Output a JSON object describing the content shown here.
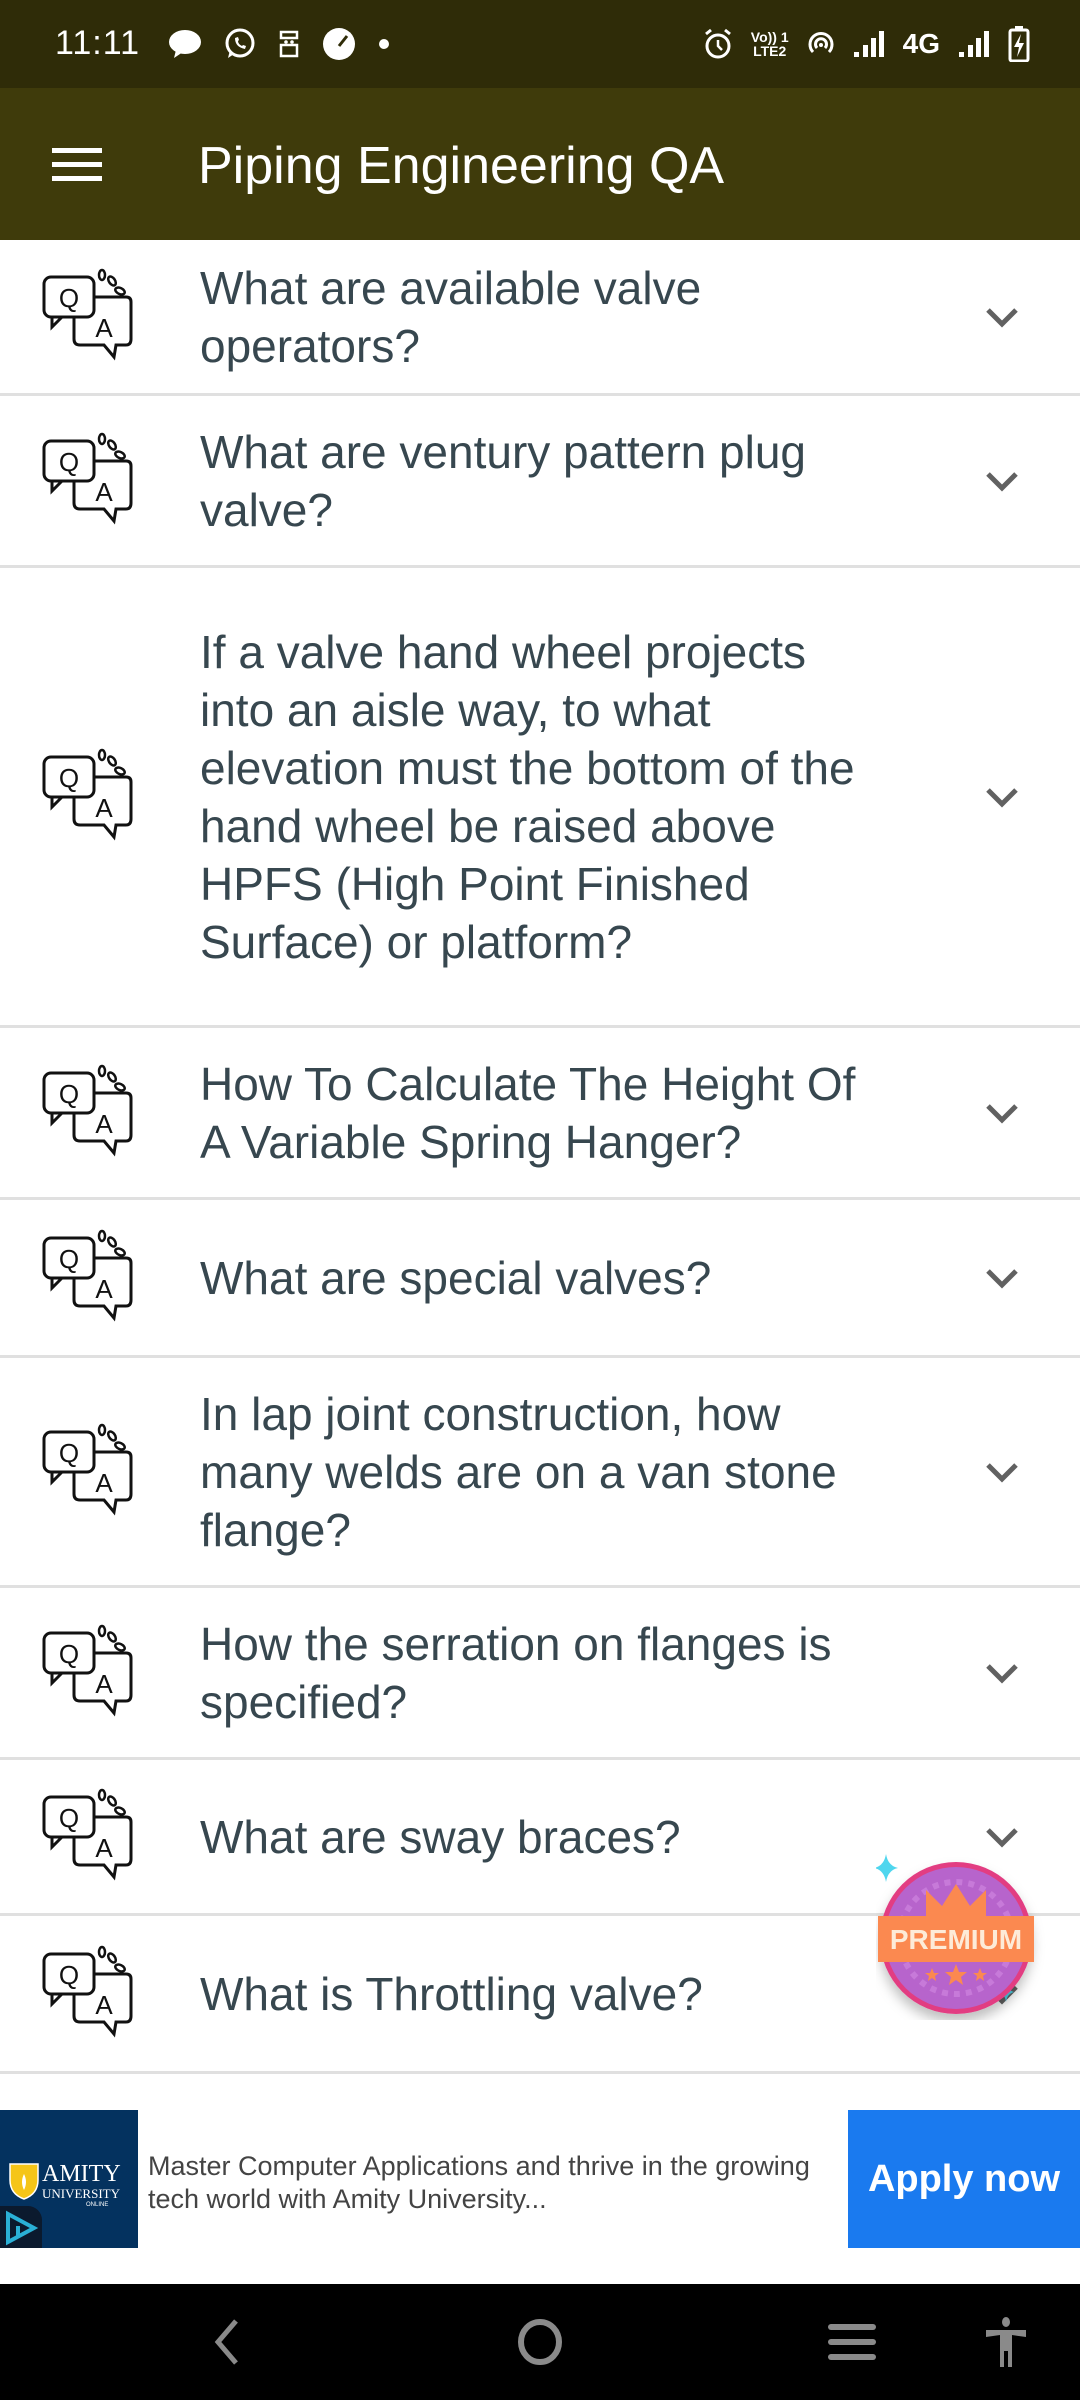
{
  "status_bar": {
    "time": "11:11",
    "left_icons": [
      "chat-bubble-icon",
      "whatsapp-icon",
      "robot-icon",
      "speedometer-icon",
      "more-notifications-dot-icon"
    ],
    "right_icons": [
      "alarm-icon",
      "volte-icon",
      "hotspot-icon",
      "signal-icon",
      "signal-icon"
    ],
    "volte_line1": "Vo)) 1",
    "volte_line2": "LTE2",
    "network_type": "4G"
  },
  "app_bar": {
    "title": "Piping Engineering QA",
    "menu_icon": "hamburger-menu-icon"
  },
  "colors": {
    "status_bar_bg": "#2f2c08",
    "app_bar_bg": "#3f3b0b",
    "question_text": "#37474f",
    "divider": "#e0e0e0",
    "chevron": "#616161",
    "ad_cta_bg": "#1a7aef",
    "ad_logo_bg": "#04325f"
  },
  "questions": [
    {
      "text": "What are available valve operators?",
      "icon": "qa-chat-icon",
      "expanded": false
    },
    {
      "text": "What are ventury pattern plug valve?",
      "icon": "qa-chat-icon",
      "expanded": false
    },
    {
      "text": "If a valve hand wheel projects into an aisle way, to what elevation must the bottom of the hand wheel be raised above HPFS (High Point Finished Surface) or platform?",
      "icon": "qa-chat-icon",
      "expanded": false
    },
    {
      "text": "How To Calculate The Height Of A Variable Spring Hanger?",
      "icon": "qa-chat-icon",
      "expanded": false
    },
    {
      "text": "What are special valves?",
      "icon": "qa-chat-icon",
      "expanded": false
    },
    {
      "text": "In lap joint construction, how many welds are on a van stone flange?",
      "icon": "qa-chat-icon",
      "expanded": false
    },
    {
      "text": "How the serration on flanges is specified?",
      "icon": "qa-chat-icon",
      "expanded": false
    },
    {
      "text": "What are sway braces?",
      "icon": "qa-chat-icon",
      "expanded": false
    },
    {
      "text": "What is Throttling valve?",
      "icon": "qa-chat-icon",
      "expanded": false
    }
  ],
  "premium_badge": {
    "label": "PREMIUM"
  },
  "ad": {
    "logo_name": "AMITY",
    "logo_sub": "UNIVERSITY",
    "logo_online": "ONLINE",
    "text": "Master Computer Applications and thrive in the growing tech world with Amity University...",
    "cta": "Apply now"
  },
  "nav_bar": {
    "buttons": [
      "back",
      "home",
      "recents",
      "accessibility"
    ]
  }
}
